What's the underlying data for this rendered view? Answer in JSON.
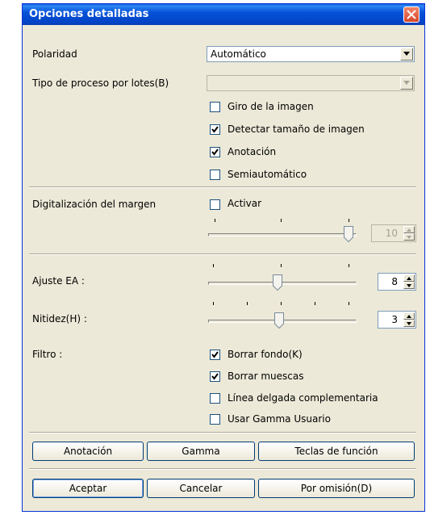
{
  "window": {
    "title": "Opciones detalladas"
  },
  "polarity": {
    "label": "Polaridad",
    "value": "Automático"
  },
  "batch": {
    "label": "Tipo de proceso por lotes(B)",
    "value": ""
  },
  "options": {
    "image_rotation": {
      "label": "Giro de la imagen",
      "checked": false
    },
    "detect_size": {
      "label": "Detectar tamaño de imagen",
      "checked": true
    },
    "annotation": {
      "label": "Anotación",
      "checked": true
    },
    "semiauto": {
      "label": "Semiautomático",
      "checked": false
    }
  },
  "margin_scan": {
    "label": "Digitalización del margen",
    "activate_label": "Activar",
    "activate_checked": false,
    "slider_value": "10"
  },
  "ea_adjust": {
    "label": "Ajuste EA :",
    "value": "8"
  },
  "sharpness": {
    "label": "Nitidez(H) :",
    "value": "3"
  },
  "filter": {
    "label": "Filtro :",
    "erase_background": {
      "label": "Borrar fondo(K)",
      "checked": true
    },
    "erase_notches": {
      "label": "Borrar muescas",
      "checked": true
    },
    "thin_line": {
      "label": "Línea delgada complementaria",
      "checked": false
    },
    "user_gamma": {
      "label": "Usar Gamma Usuario",
      "checked": false
    }
  },
  "buttons": {
    "annotation": "Anotación",
    "gamma": "Gamma",
    "function_keys": "Teclas de función",
    "ok": "Aceptar",
    "cancel": "Cancelar",
    "default": "Por omisión(D)"
  },
  "colors": {
    "title_bar": "#0552d8",
    "close_button": "#d8462a",
    "dialog_bg": "#ece9d8",
    "checkmark": "#21a121"
  }
}
